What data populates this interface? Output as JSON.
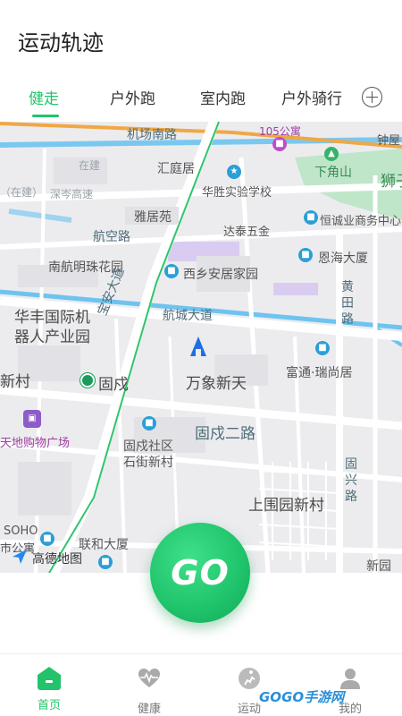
{
  "header": {
    "title": "运动轨迹"
  },
  "tabs": [
    {
      "label": "健走",
      "active": true
    },
    {
      "label": "户外跑"
    },
    {
      "label": "室内跑"
    },
    {
      "label": "户外骑行"
    }
  ],
  "map": {
    "labels": {
      "airport_south_road": "机场南路",
      "residence_105": "105公寓",
      "zhongpu": "钟屋",
      "zaixin": "在建",
      "huitingju": "汇庭居",
      "xiajiaoshan": "下角山",
      "shizi": "狮子",
      "shenzhen_cen_expressway": "深岑高速",
      "zaijian_prefix": "（在建）",
      "huasheng_school": "华胜实验学校",
      "yajuyuan": "雅居苑",
      "datai_wujin": "达泰五金",
      "hengcheng_center": "恒诚业商务中心",
      "hangkong_road": "航空路",
      "enhai_building": "恩海大厦",
      "nanhang_mingzhu": "南航明珠花园",
      "xixiang_anju": "西乡安居家园",
      "huangtian_road": "黄田路",
      "baoan_avenue": "宝安大道",
      "hangcheng_avenue": "航城大道",
      "huafeng_robot": "华丰国际机器人产业园",
      "fuyong_ruishangju": "富通·瑞尚居",
      "xincun": "新村",
      "gushu": "固戍",
      "wanxiang_xintian": "万象新天",
      "tiandi_mall": "天地购物广场",
      "gushu_second_road": "固戍二路",
      "gushu_community": "固戍社区",
      "shijie_xincun": "石街新村",
      "guxing_road": "固兴路",
      "shangwei_xincun": "上围园新村",
      "soho": "SOHO",
      "shi_gongyu": "市公寓",
      "lianhe_building": "联和大厦",
      "amap": "高德地图",
      "xinwei": "新园",
      "metro_station": "固戍"
    }
  },
  "go_button": {
    "label": "GO"
  },
  "bottom_nav": [
    {
      "label": "首页",
      "active": true,
      "icon": "home-icon"
    },
    {
      "label": "健康",
      "icon": "heart-pulse-icon"
    },
    {
      "label": "运动",
      "icon": "run-icon"
    },
    {
      "label": "我的",
      "icon": "user-icon"
    }
  ],
  "watermark": {
    "text": "GOGO手游网"
  },
  "colors": {
    "accent": "#22c36b",
    "map_bg": "#ececef",
    "road": "#ffffff",
    "water": "#6ec3ef",
    "route_green": "#22c36b"
  }
}
